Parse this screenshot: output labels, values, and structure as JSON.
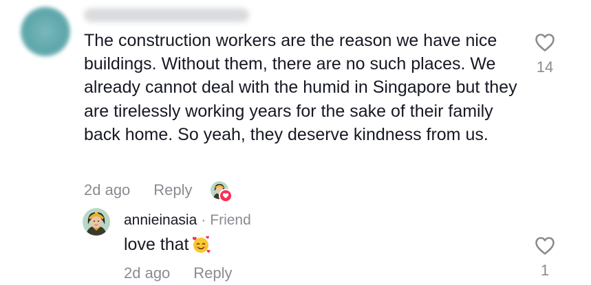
{
  "comment": {
    "text": "The construction workers are the reason we have nice buildings. Without them, there are no such places. We already cannot deal with the humid in Singapore but they are tirelessly working years for the sake of their family back home. So yeah, they deserve kindness from us.",
    "time": "2d ago",
    "reply_label": "Reply",
    "like_count": "14",
    "like_icon": "heart-outline-icon",
    "creator_liked_icon": "heart-filled-icon"
  },
  "reply": {
    "username": "annieinasia",
    "separator": "·",
    "relation": "Friend",
    "text": "love that",
    "emoji": "smiling-face-with-hearts-emoji",
    "time": "2d ago",
    "reply_label": "Reply",
    "like_count": "1",
    "like_icon": "heart-outline-icon"
  },
  "colors": {
    "text": "#161823",
    "muted": "#8a8b91",
    "accent": "#fe2c55"
  }
}
